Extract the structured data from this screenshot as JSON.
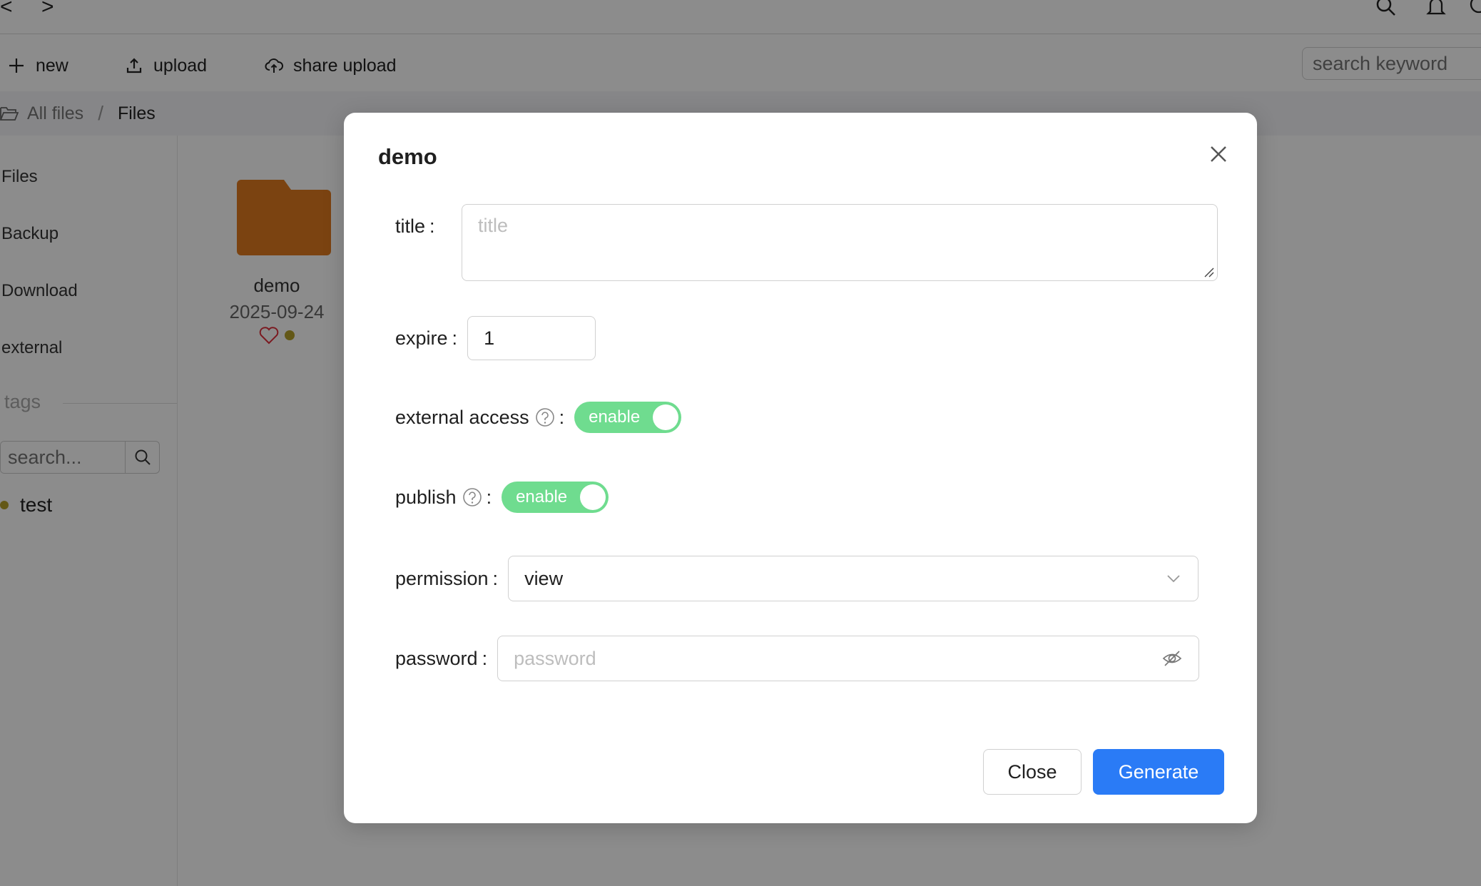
{
  "topbar": {
    "back_glyph": "<",
    "forward_glyph": ">"
  },
  "toolbar": {
    "new_label": "new",
    "upload_label": "upload",
    "share_upload_label": "share upload",
    "search_placeholder": "search keyword"
  },
  "breadcrumb": {
    "root": "All files",
    "separator": "/",
    "current": "Files"
  },
  "sidebar": {
    "items": [
      {
        "label": "Files"
      },
      {
        "label": "Backup"
      },
      {
        "label": "Download"
      },
      {
        "label": "external"
      }
    ],
    "tags_heading": "tags",
    "tag_search_placeholder": "search...",
    "tags": [
      {
        "label": "test",
        "color": "#b5a12a"
      }
    ]
  },
  "files": [
    {
      "name": "demo",
      "date": "2025-09-24",
      "folder_color": "#e07b1f",
      "tag_color": "#b5a12a"
    }
  ],
  "modal": {
    "title": "demo",
    "fields": {
      "title": {
        "label": "title",
        "placeholder": "title",
        "value": ""
      },
      "expire": {
        "label": "expire",
        "value": "1"
      },
      "external_access": {
        "label": "external access",
        "state_label": "enable",
        "enabled": true
      },
      "publish": {
        "label": "publish",
        "state_label": "enable",
        "enabled": true
      },
      "permission": {
        "label": "permission",
        "value": "view"
      },
      "password": {
        "label": "password",
        "placeholder": "password",
        "value": ""
      }
    },
    "colon": ":",
    "close_label": "Close",
    "generate_label": "Generate"
  },
  "colors": {
    "accent": "#2a7bf6",
    "switch_on": "#6fdc8f",
    "overlay": "rgba(0,0,0,0.45)"
  }
}
